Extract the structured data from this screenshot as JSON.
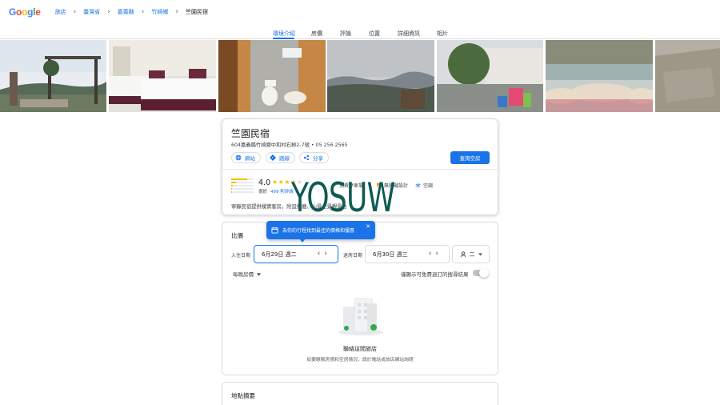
{
  "brand": {
    "logo_letters": [
      "G",
      "o",
      "o",
      "g",
      "l",
      "e"
    ]
  },
  "breadcrumb": {
    "items": [
      "旅店",
      "臺灣省",
      "嘉義縣",
      "竹崎鄉"
    ],
    "current": "竺園民宿",
    "separator": "›"
  },
  "tabs": [
    {
      "label": "環境介紹",
      "active": true
    },
    {
      "label": "房價",
      "active": false
    },
    {
      "label": "評論",
      "active": false
    },
    {
      "label": "位置",
      "active": false
    },
    {
      "label": "詳細資訊",
      "active": false
    },
    {
      "label": "相片",
      "active": false
    }
  ],
  "hotel": {
    "name": "竺園民宿",
    "address_line": "604嘉義縣竹崎鄉中和村石棹2-7號 • 05 256 2565",
    "actions": [
      {
        "label": "網站",
        "icon": "globe-icon"
      },
      {
        "label": "路線",
        "icon": "directions-icon"
      },
      {
        "label": "分享",
        "icon": "share-icon"
      }
    ],
    "primary_button": "查詢空房",
    "rating": {
      "score": "4.0",
      "stars": 4,
      "label": "很好",
      "reviews": "499 則評論",
      "distribution": [
        0.72,
        0.22,
        0.06,
        0.03,
        0.04
      ]
    },
    "amenities": [
      {
        "label": "免費停車場",
        "icon": "parking-icon"
      },
      {
        "label": "無障礙設計",
        "icon": "flag-icon"
      },
      {
        "label": "空調",
        "icon": "snowflake-icon"
      }
    ],
    "description": "寧靜民宿提供樸實客房，附設餐廳、山景全景觀景台"
  },
  "tooltip": {
    "text": "為你的行程找到最佳的價格和優惠",
    "icon": "calendar-icon"
  },
  "pricing": {
    "title": "比價",
    "checkin_label": "入住日期",
    "checkin_value": "6月29日 週二",
    "checkout_label": "退房日期",
    "checkout_value": "6月30日 週三",
    "guests_value": "二",
    "per_night": "每晚房價",
    "free_cancel_label": "僅顯示可免費退訂的搜尋結果",
    "free_cancel_on": false,
    "empty_title": "聯絡這間旅店",
    "empty_subtitle": "如要瞭解房價和空房情況，請於電話或旅店網站詢問"
  },
  "location": {
    "title": "地點摘要"
  },
  "watermark": "YOSUW",
  "colors": {
    "accent": "#1a73e8",
    "star": "#fbbc04",
    "watermark": "#0e5a52"
  }
}
